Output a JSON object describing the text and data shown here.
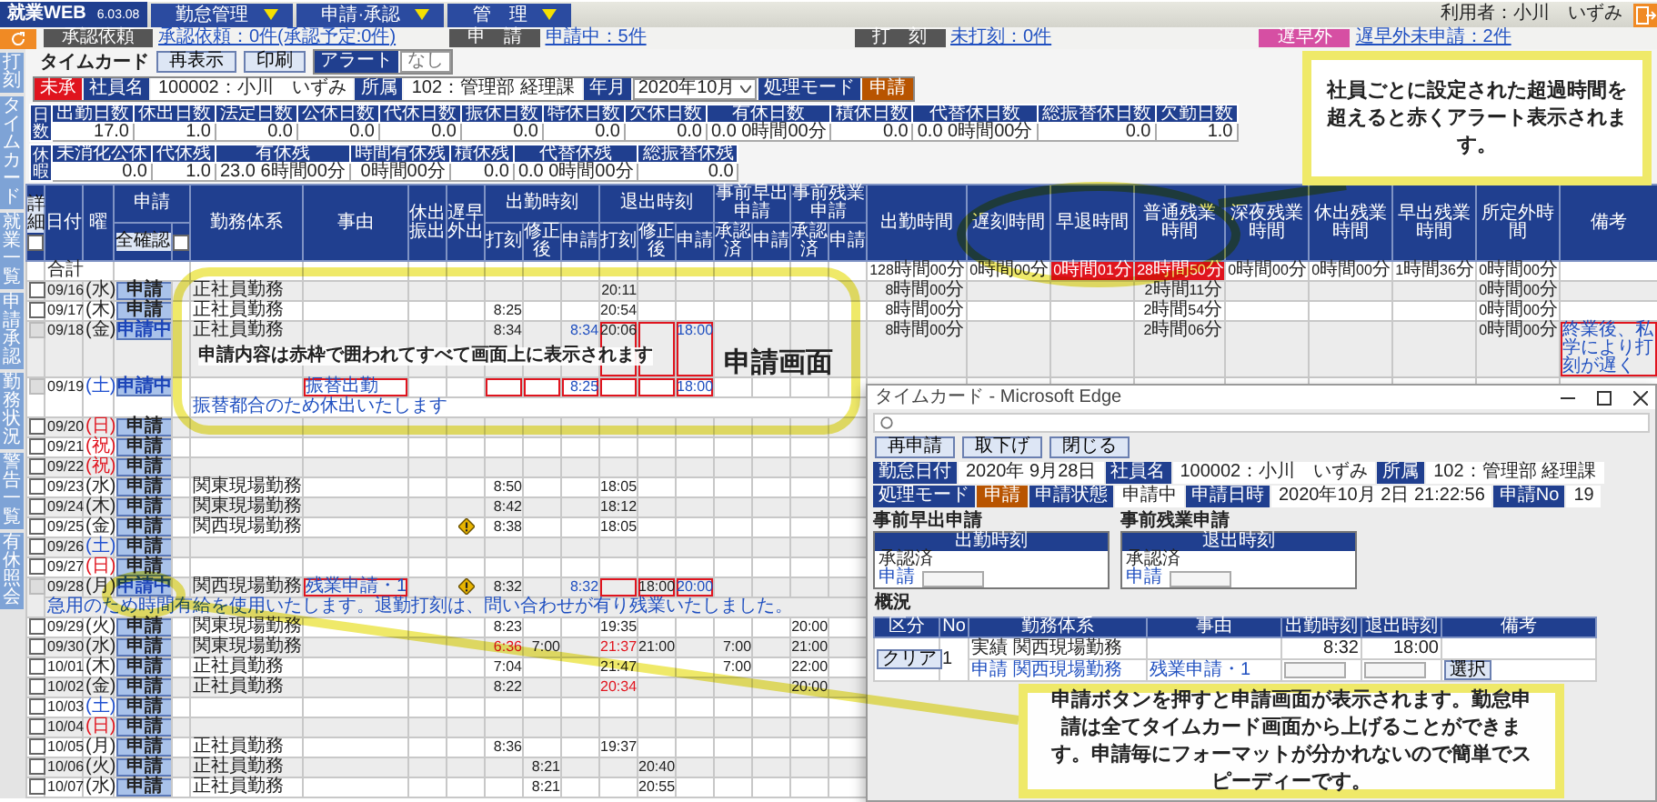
{
  "header": {
    "logo": "就業WEB",
    "version": "6.03.08",
    "menus": [
      "勤怠管理",
      "申請·承認",
      "管　理"
    ],
    "user": "利用者：小川　いずみ"
  },
  "status": [
    {
      "label": "承認依頼",
      "link": "承認依頼：0件(承認予定:0件)",
      "kind": "gray"
    },
    {
      "label": "申　請",
      "link": "申請中：5件",
      "kind": "gray"
    },
    {
      "label": "打　刻",
      "link": "未打刻：0件",
      "kind": "gray"
    },
    {
      "label": "遅早外",
      "link": "遅早外未申請：2件",
      "kind": "pink"
    }
  ],
  "sidebar": [
    "打刻",
    "タイムカード",
    "就業一覧",
    "申請承認",
    "勤務状況",
    "警告一覧",
    "有休照会"
  ],
  "title": "タイムカード",
  "buttons": [
    "再表示",
    "印刷"
  ],
  "alert": {
    "label": "アラート",
    "value": "なし"
  },
  "info": [
    {
      "kind": "badge",
      "value": "未承"
    },
    {
      "kind": "field",
      "label": "社員名",
      "value": "100002：小川　いずみ"
    },
    {
      "kind": "field",
      "label": "所属",
      "value": "102：管理部 経理課"
    },
    {
      "kind": "select",
      "label": "年月",
      "value": "2020年10月"
    },
    {
      "kind": "mode",
      "label": "処理モード",
      "value": "申請"
    }
  ],
  "summaries": [
    {
      "side": "日数",
      "columns": [
        "出勤日数",
        "休出日数",
        "法定日数",
        "公休日数",
        "代休日数",
        "振休日数",
        "特休日数",
        "欠休日数",
        "有休日数",
        "積休日数",
        "代替休日数",
        "総振替休日数",
        "欠勤日数"
      ],
      "values": [
        "17.0",
        "1.0",
        "0.0",
        "0.0",
        "0.0",
        "0.0",
        "0.0",
        "0.0",
        "0.0 0時間00分",
        "0.0",
        "0.0 0時間00分",
        "0.0",
        "1.0"
      ]
    },
    {
      "side": "休暇",
      "columns": [
        "未消化公休",
        "代休残",
        "有休残",
        "時間有休残",
        "積休残",
        "代替休残",
        "総振替休残"
      ],
      "values": [
        "0.0",
        "1.0",
        "23.0 6時間00分",
        "0時間00分",
        "0.0",
        "0.0 0時間00分",
        "0.0"
      ]
    }
  ],
  "table": {
    "headers": [
      {
        "kind": "check",
        "label": "詳細",
        "checked": false
      },
      {
        "kind": "date",
        "label": "日付"
      },
      {
        "kind": "dow",
        "label": "曜"
      },
      {
        "kind": "apply",
        "label": "申請",
        "button": "全確認",
        "checked": false
      },
      {
        "kind": "text",
        "label": "勤務体系"
      },
      {
        "kind": "text",
        "label": "事由"
      },
      {
        "kind": "text",
        "label": "休出振出"
      },
      {
        "kind": "flag",
        "label": "遅早外出"
      },
      {
        "kind": "group",
        "label": "出勤時刻",
        "children": [
          {
            "label": "打刻",
            "accent": false
          },
          {
            "label": "修正後",
            "accent": false
          },
          {
            "label": "申請",
            "accent": true
          }
        ]
      },
      {
        "kind": "group",
        "label": "退出時刻",
        "children": [
          {
            "label": "打刻",
            "accent": false
          },
          {
            "label": "修正後",
            "accent": false
          },
          {
            "label": "申請",
            "accent": true
          }
        ]
      },
      {
        "kind": "group",
        "label": "事前早出申請",
        "children": [
          {
            "label": "承認済",
            "accent": false
          },
          {
            "label": "申請"
          }
        ]
      },
      {
        "kind": "group",
        "label": "事前残業申請",
        "children": [
          {
            "label": "承認済",
            "accent": false
          },
          {
            "label": "申請"
          }
        ]
      },
      {
        "kind": "duration",
        "label": "出勤時間"
      },
      {
        "kind": "duration",
        "label": "遅刻時間"
      },
      {
        "kind": "duration",
        "label": "早退時間"
      },
      {
        "kind": "duration",
        "label": "普通残業時間"
      },
      {
        "kind": "duration",
        "label": "深夜残業時間"
      },
      {
        "kind": "duration",
        "label": "休出残業時間"
      },
      {
        "kind": "duration",
        "label": "早出残業時間"
      },
      {
        "kind": "duration",
        "label": "所定外時間"
      },
      {
        "kind": "note",
        "label": "備考"
      }
    ],
    "total": {
      "label": "合計",
      "cells": [
        null,
        null,
        null,
        null,
        null,
        null,
        null,
        null,
        null,
        null,
        null,
        null,
        null,
        null,
        {
          "text": "128時間00分",
          "alert": false
        },
        {
          "text": "0時間00分",
          "alert": false
        },
        {
          "text": "0時間01分",
          "alert": true
        },
        {
          "text": "28時間50分",
          "alert": true
        },
        {
          "text": "0時間00分",
          "alert": false
        },
        {
          "text": "0時間00分",
          "alert": false
        },
        {
          "text": "1時間36分",
          "alert": false
        },
        {
          "text": "0時間00分",
          "alert": false
        },
        null
      ]
    },
    "rows": [
      {
        "date": "09/16",
        "dow": "(水)",
        "color": "#222222",
        "apply": "申請",
        "pending": false,
        "disabled": false,
        "warning": false,
        "cells": [
          {
            "text": "正社員勤務",
            "alert": false,
            "framed": false
          },
          null,
          null,
          null,
          null,
          null,
          null,
          {
            "text": "20:11",
            "alert": false,
            "framed": false
          },
          null,
          null,
          null,
          null,
          null,
          null,
          {
            "text": "8時間00分",
            "alert": false,
            "framed": false
          },
          null,
          null,
          {
            "text": "2時間11分",
            "alert": false,
            "framed": false
          },
          null,
          null,
          null,
          {
            "text": "0時間00分",
            "alert": false,
            "framed": false
          },
          null
        ]
      },
      {
        "date": "09/17",
        "dow": "(木)",
        "color": "#222222",
        "apply": "申請",
        "pending": false,
        "disabled": false,
        "warning": false,
        "cells": [
          {
            "text": "正社員勤務",
            "alert": false,
            "framed": false
          },
          null,
          null,
          null,
          {
            "text": "8:25",
            "alert": false,
            "framed": false
          },
          null,
          null,
          {
            "text": "20:54",
            "alert": false,
            "framed": false
          },
          null,
          null,
          null,
          null,
          null,
          null,
          {
            "text": "8時間00分",
            "alert": false,
            "framed": false
          },
          null,
          null,
          {
            "text": "2時間54分",
            "alert": false,
            "framed": false
          },
          null,
          null,
          null,
          {
            "text": "0時間00分",
            "alert": false,
            "framed": false
          },
          null
        ]
      },
      {
        "date": "09/18",
        "dow": "(金)",
        "color": "#222222",
        "apply": "申請中",
        "pending": true,
        "disabled": true,
        "warning": false,
        "cells": [
          {
            "text": "正社員勤務",
            "alert": false,
            "framed": false
          },
          null,
          null,
          null,
          {
            "text": "8:34",
            "alert": false,
            "framed": false
          },
          null,
          {
            "text": "8:34",
            "alert": false,
            "framed": false
          },
          {
            "text": "20:06",
            "alert": false,
            "framed": true
          },
          {
            "alert": false,
            "framed": true
          },
          {
            "text": "18:00",
            "alert": false,
            "framed": true
          },
          null,
          null,
          null,
          null,
          {
            "text": "8時間00分",
            "alert": false,
            "framed": false
          },
          null,
          null,
          {
            "text": "2時間06分",
            "alert": false,
            "framed": false
          },
          null,
          null,
          null,
          {
            "text": "0時間00分",
            "alert": false,
            "framed": false
          },
          {
            "text": "終業後、私学により打刻が遅く",
            "alert": false,
            "framed": true
          }
        ]
      },
      {
        "date": "09/19",
        "dow": "(土)",
        "color": "#2050d0",
        "apply": "申請中",
        "pending": true,
        "disabled": true,
        "warning": false,
        "comment": "振替都合のため休出いたします",
        "cells": [
          null,
          {
            "text": "振替出勤",
            "alert": false,
            "framed": true
          },
          null,
          null,
          {
            "alert": false,
            "framed": true
          },
          {
            "alert": false,
            "framed": true
          },
          {
            "text": "8:25",
            "alert": false,
            "framed": true
          },
          {
            "alert": false,
            "framed": true
          },
          {
            "alert": false,
            "framed": true
          },
          {
            "text": "18:00",
            "alert": false,
            "framed": true
          },
          null,
          null,
          null,
          null,
          null,
          null,
          null,
          null,
          null,
          null,
          null,
          null,
          null
        ]
      },
      {
        "date": "09/20",
        "dow": "(日)",
        "color": "#e0141e",
        "apply": "申請",
        "pending": false,
        "disabled": false,
        "warning": false,
        "cells": []
      },
      {
        "date": "09/21",
        "dow": "(祝)",
        "color": "#e0141e",
        "apply": "申請",
        "pending": false,
        "disabled": false,
        "warning": false,
        "cells": []
      },
      {
        "date": "09/22",
        "dow": "(祝)",
        "color": "#e0141e",
        "apply": "申請",
        "pending": false,
        "disabled": false,
        "warning": false,
        "cells": []
      },
      {
        "date": "09/23",
        "dow": "(水)",
        "color": "#222222",
        "apply": "申請",
        "pending": false,
        "disabled": false,
        "warning": false,
        "cells": [
          {
            "text": "関東現場勤務",
            "alert": false,
            "framed": false
          },
          null,
          null,
          null,
          {
            "text": "8:50",
            "alert": false,
            "framed": false
          },
          null,
          null,
          {
            "text": "18:05",
            "alert": false,
            "framed": false
          }
        ]
      },
      {
        "date": "09/24",
        "dow": "(木)",
        "color": "#222222",
        "apply": "申請",
        "pending": false,
        "disabled": false,
        "warning": false,
        "cells": [
          {
            "text": "関東現場勤務",
            "alert": false,
            "framed": false
          },
          null,
          null,
          null,
          {
            "text": "8:42",
            "alert": false,
            "framed": false
          },
          null,
          null,
          {
            "text": "18:12",
            "alert": false,
            "framed": false
          }
        ]
      },
      {
        "date": "09/25",
        "dow": "(金)",
        "color": "#222222",
        "apply": "申請",
        "pending": false,
        "disabled": false,
        "warning": true,
        "cells": [
          {
            "text": "関西現場勤務",
            "alert": false,
            "framed": false
          },
          null,
          null,
          null,
          {
            "text": "8:38",
            "alert": false,
            "framed": false
          },
          null,
          null,
          {
            "text": "18:05",
            "alert": false,
            "framed": false
          }
        ]
      },
      {
        "date": "09/26",
        "dow": "(土)",
        "color": "#2050d0",
        "apply": "申請",
        "pending": false,
        "disabled": false,
        "warning": false,
        "cells": []
      },
      {
        "date": "09/27",
        "dow": "(日)",
        "color": "#e0141e",
        "apply": "申請",
        "pending": false,
        "disabled": false,
        "warning": false,
        "cells": []
      },
      {
        "date": "09/28",
        "dow": "(月)",
        "color": "#222222",
        "apply": "申請中",
        "pending": true,
        "disabled": true,
        "warning": true,
        "comment": "急用のため時間有給を使用いたします。退勤打刻は、問い合わせが有り残業いたしました。",
        "cells": [
          {
            "text": "関西現場勤務",
            "alert": false,
            "framed": false
          },
          {
            "text": "残業申請・1",
            "alert": false,
            "framed": true
          },
          null,
          null,
          {
            "text": "8:32",
            "alert": false,
            "framed": false
          },
          null,
          {
            "text": "8:32",
            "alert": false,
            "framed": false
          },
          {
            "alert": false,
            "framed": true
          },
          {
            "text": "18:00",
            "alert": false,
            "framed": true
          },
          {
            "text": "20:00",
            "alert": false,
            "framed": true
          }
        ]
      },
      {
        "date": "09/29",
        "dow": "(火)",
        "color": "#222222",
        "apply": "申請",
        "pending": false,
        "disabled": false,
        "warning": false,
        "cells": [
          {
            "text": "関東現場勤務",
            "alert": false,
            "framed": false
          },
          null,
          null,
          null,
          {
            "text": "8:23",
            "alert": false,
            "framed": false
          },
          null,
          null,
          {
            "text": "19:35",
            "alert": false,
            "framed": false
          },
          null,
          null,
          null,
          null,
          {
            "text": "20:00",
            "alert": false,
            "framed": false
          }
        ]
      },
      {
        "date": "09/30",
        "dow": "(水)",
        "color": "#222222",
        "apply": "申請",
        "pending": false,
        "disabled": false,
        "warning": false,
        "cells": [
          {
            "text": "関東現場勤務",
            "alert": false,
            "framed": false
          },
          null,
          null,
          null,
          {
            "text": "6:36",
            "alert": true,
            "framed": false
          },
          {
            "text": "7:00",
            "alert": false,
            "framed": false
          },
          null,
          {
            "text": "21:37",
            "alert": true,
            "framed": false
          },
          {
            "text": "21:00",
            "alert": false,
            "framed": false
          },
          null,
          {
            "text": "7:00",
            "alert": false,
            "framed": false
          },
          null,
          {
            "text": "21:00",
            "alert": false,
            "framed": false
          }
        ]
      },
      {
        "date": "10/01",
        "dow": "(木)",
        "color": "#222222",
        "apply": "申請",
        "pending": false,
        "disabled": false,
        "warning": false,
        "cells": [
          {
            "text": "正社員勤務",
            "alert": false,
            "framed": false
          },
          null,
          null,
          null,
          {
            "text": "7:04",
            "alert": false,
            "framed": false
          },
          null,
          null,
          {
            "text": "21:47",
            "alert": false,
            "framed": false
          },
          null,
          null,
          {
            "text": "7:00",
            "alert": false,
            "framed": false
          },
          null,
          {
            "text": "22:00",
            "alert": false,
            "framed": false
          }
        ]
      },
      {
        "date": "10/02",
        "dow": "(金)",
        "color": "#222222",
        "apply": "申請",
        "pending": false,
        "disabled": false,
        "warning": false,
        "cells": [
          {
            "text": "正社員勤務",
            "alert": false,
            "framed": false
          },
          null,
          null,
          null,
          {
            "text": "8:22",
            "alert": false,
            "framed": false
          },
          null,
          null,
          {
            "text": "20:34",
            "alert": true,
            "framed": false
          },
          null,
          null,
          null,
          null,
          {
            "text": "20:00",
            "alert": false,
            "framed": false
          }
        ]
      },
      {
        "date": "10/03",
        "dow": "(土)",
        "color": "#2050d0",
        "apply": "申請",
        "pending": false,
        "disabled": false,
        "warning": false,
        "cells": []
      },
      {
        "date": "10/04",
        "dow": "(日)",
        "color": "#e0141e",
        "apply": "申請",
        "pending": false,
        "disabled": false,
        "warning": false,
        "cells": []
      },
      {
        "date": "10/05",
        "dow": "(月)",
        "color": "#222222",
        "apply": "申請",
        "pending": false,
        "disabled": false,
        "warning": false,
        "cells": [
          {
            "text": "正社員勤務",
            "alert": false,
            "framed": false
          },
          null,
          null,
          null,
          {
            "text": "8:36",
            "alert": false,
            "framed": false
          },
          null,
          null,
          {
            "text": "19:37",
            "alert": false,
            "framed": false
          }
        ]
      },
      {
        "date": "10/06",
        "dow": "(火)",
        "color": "#222222",
        "apply": "申請",
        "pending": false,
        "disabled": false,
        "warning": false,
        "cells": [
          {
            "text": "正社員勤務",
            "alert": false,
            "framed": false
          },
          null,
          null,
          null,
          null,
          {
            "text": "8:21",
            "alert": false,
            "framed": false
          },
          null,
          null,
          {
            "text": "20:40",
            "alert": false,
            "framed": false
          }
        ]
      },
      {
        "date": "10/07",
        "dow": "(水)",
        "color": "#222222",
        "apply": "申請",
        "pending": false,
        "disabled": false,
        "warning": false,
        "cells": [
          {
            "text": "正社員勤務",
            "alert": false,
            "framed": false
          },
          null,
          null,
          null,
          null,
          {
            "text": "8:21",
            "alert": false,
            "framed": false
          },
          null,
          null,
          {
            "text": "20:55",
            "alert": false,
            "framed": false
          }
        ]
      }
    ]
  },
  "popup": {
    "title": "タイムカード - Microsoft Edge",
    "buttons": [
      "再申請",
      "取下げ",
      "閉じる"
    ],
    "info": [
      {
        "kind": "text",
        "label": "勤怠日付",
        "value": "2020年 9月28日"
      },
      {
        "kind": "text",
        "label": "社員名",
        "value": "100002：小川　いずみ"
      },
      {
        "kind": "text",
        "label": "所属",
        "value": "102：管理部 経理課"
      },
      {
        "kind": "mode",
        "label": "処理モード",
        "value": "申請"
      },
      {
        "kind": "text",
        "label": "申請状態",
        "value": "申請中"
      },
      {
        "kind": "text",
        "label": "申請日時",
        "value": "2020年10月 2日 21:22:56"
      },
      {
        "kind": "text",
        "label": "申請No",
        "value": "19"
      }
    ],
    "pre_requests": [
      {
        "title": "事前早出申請",
        "header": "出勤時刻",
        "approved": "承認済",
        "request": "申請"
      },
      {
        "title": "事前残業申請",
        "header": "退出時刻",
        "approved": "承認済",
        "request": "申請"
      }
    ],
    "overview": {
      "title": "概況",
      "columns": [
        "区分",
        "No",
        "勤務体系",
        "事由",
        "出勤時刻",
        "退出時刻",
        "備考"
      ],
      "clear": "クリア",
      "no": "1",
      "select": "選択",
      "rows": [
        {
          "type": "実績",
          "work": "関西現場勤務",
          "in": "8:32",
          "out": "18:00"
        },
        {
          "type": "申請",
          "work": "関西現場勤務",
          "reason": "残業申請・1"
        }
      ]
    }
  },
  "callouts": [
    {
      "kind": "box",
      "text": "社員ごとに設定された超過時間を超えると赤くアラート表示されます。"
    },
    {
      "kind": "ellipse",
      "text": "申請内容は赤枠で囲われてすべて画面上に表示されます"
    },
    {
      "kind": "label",
      "text": "申請画面"
    },
    {
      "kind": "box",
      "text": "申請ボタンを押すと申請画面が表示されます。勤怠申請は全てタイムカード画面から上げることができます。申請毎にフォーマットが分かれないので簡単でスピーディーです。"
    }
  ]
}
